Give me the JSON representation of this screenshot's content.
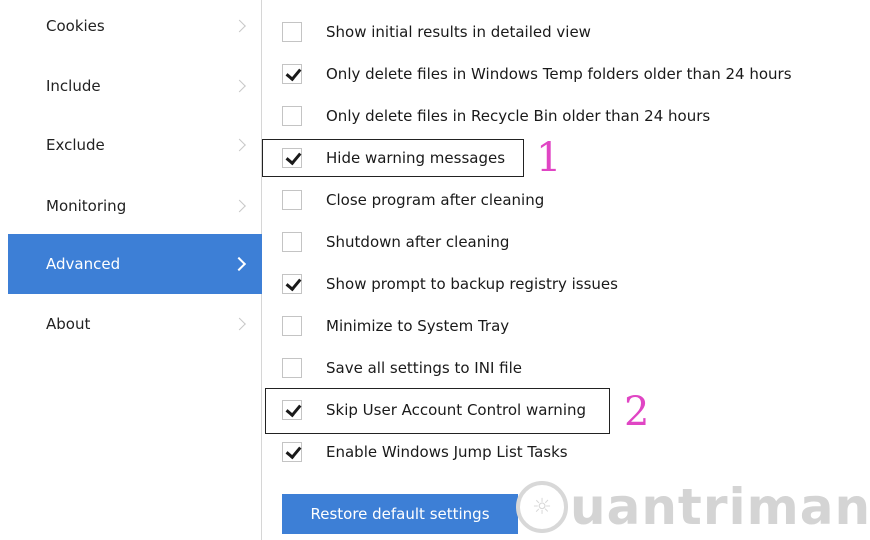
{
  "sidebar": {
    "items": [
      {
        "label": "Cookies",
        "active": false
      },
      {
        "label": "Include",
        "active": false
      },
      {
        "label": "Exclude",
        "active": false
      },
      {
        "label": "Monitoring",
        "active": false
      },
      {
        "label": "Advanced",
        "active": true
      },
      {
        "label": "About",
        "active": false
      }
    ]
  },
  "options": [
    {
      "label": "Show initial results in detailed view",
      "checked": false
    },
    {
      "label": "Only delete files in Windows Temp folders older than 24 hours",
      "checked": true
    },
    {
      "label": "Only delete files in Recycle Bin older than 24 hours",
      "checked": false
    },
    {
      "label": "Hide warning messages",
      "checked": true
    },
    {
      "label": "Close program after cleaning",
      "checked": false
    },
    {
      "label": "Shutdown after cleaning",
      "checked": false
    },
    {
      "label": "Show prompt to backup registry issues",
      "checked": true
    },
    {
      "label": "Minimize to System Tray",
      "checked": false
    },
    {
      "label": "Save all settings to INI file",
      "checked": false
    },
    {
      "label": "Skip User Account Control warning",
      "checked": true
    },
    {
      "label": "Enable Windows Jump List Tasks",
      "checked": true
    }
  ],
  "annotations": {
    "first": "1",
    "second": "2"
  },
  "restore_button": {
    "label": "Restore default settings"
  },
  "watermark": {
    "text": "uantrimang",
    "logo_glyph": "☼"
  },
  "colors": {
    "accent": "#3d7fd6",
    "annotation": "#e045c4"
  }
}
